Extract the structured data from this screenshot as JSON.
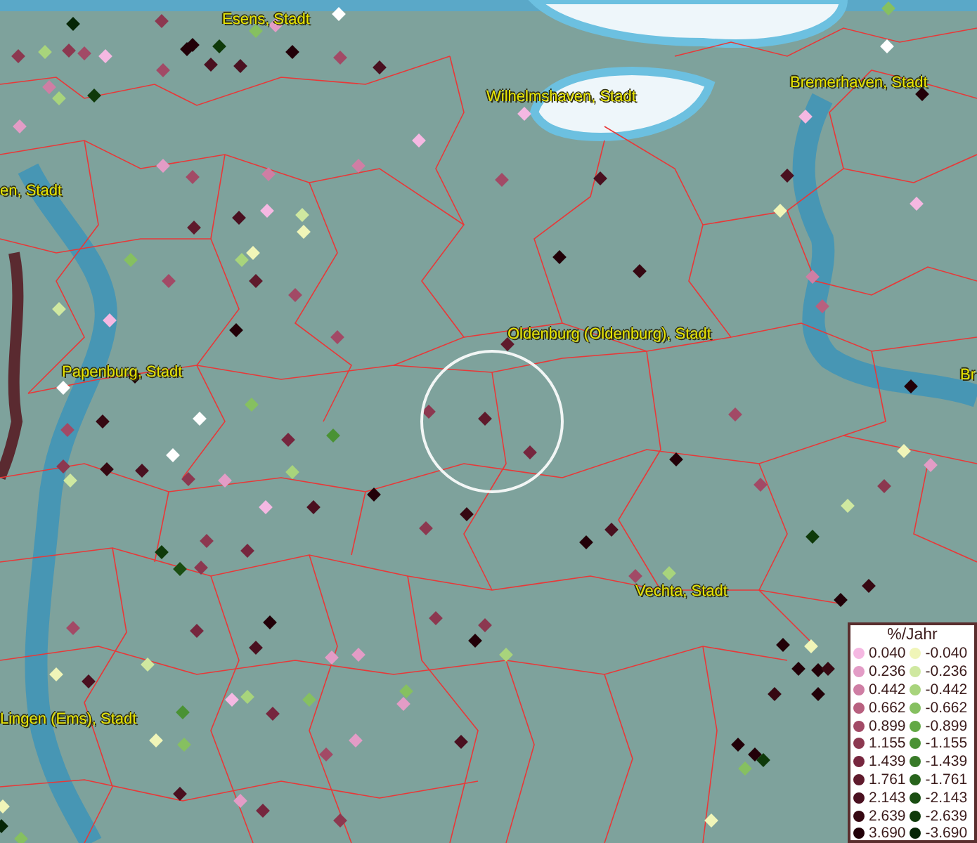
{
  "map_labels": [
    {
      "text": "Esens, Stadt"
    },
    {
      "text": "Wilhelmshaven, Stadt"
    },
    {
      "text": "Bremerhaven, Stadt"
    },
    {
      "text": "en, Stadt"
    },
    {
      "text": "Oldenburg (Oldenburg), Stadt"
    },
    {
      "text": "Papenburg, Stadt"
    },
    {
      "text": "Br"
    },
    {
      "text": "Vechta, Stadt"
    },
    {
      "text": "Lingen (Ems), Stadt"
    }
  ],
  "legend": {
    "title": "%/Jahr",
    "positive": [
      {
        "value": "0.040",
        "color": "#f5b8e2"
      },
      {
        "value": "0.236",
        "color": "#e39cc6"
      },
      {
        "value": "0.442",
        "color": "#cf7ea4"
      },
      {
        "value": "0.662",
        "color": "#b8607f"
      },
      {
        "value": "0.899",
        "color": "#a24a66"
      },
      {
        "value": "1.155",
        "color": "#8c3850"
      },
      {
        "value": "1.439",
        "color": "#76263e"
      },
      {
        "value": "1.761",
        "color": "#5f1a2c"
      },
      {
        "value": "2.143",
        "color": "#4a1020"
      },
      {
        "value": "2.639",
        "color": "#360812"
      },
      {
        "value": "3.690",
        "color": "#220008"
      }
    ],
    "negative": [
      {
        "value": "-0.040",
        "color": "#f0f5b8"
      },
      {
        "value": "-0.236",
        "color": "#cfe8a0"
      },
      {
        "value": "-0.442",
        "color": "#a8d47c"
      },
      {
        "value": "-0.662",
        "color": "#86c060"
      },
      {
        "value": "-0.899",
        "color": "#62a844"
      },
      {
        "value": "-1.155",
        "color": "#4a9234"
      },
      {
        "value": "-1.439",
        "color": "#387a28"
      },
      {
        "value": "-1.761",
        "color": "#28641c"
      },
      {
        "value": "-2.143",
        "color": "#1a4e12"
      },
      {
        "value": "-2.639",
        "color": "#0f3a0a"
      },
      {
        "value": "-3.690",
        "color": "#062606"
      }
    ]
  }
}
